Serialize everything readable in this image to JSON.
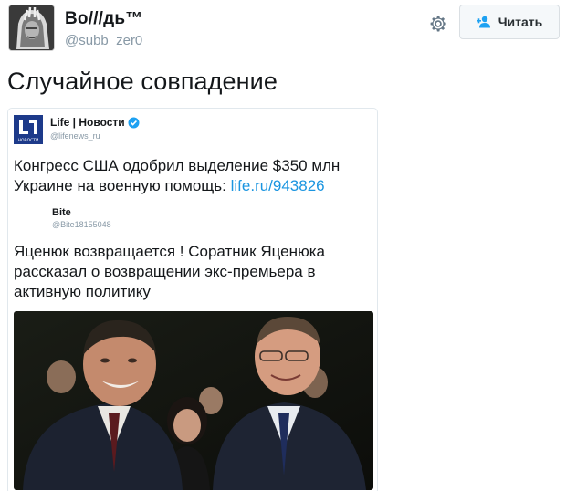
{
  "header": {
    "display_name": "Bo///дь™",
    "handle": "@subb_zer0",
    "follow_label": "Читать",
    "icons": {
      "settings": "gear-icon",
      "follow": "person-add-icon"
    }
  },
  "tweet": {
    "text": "Случайное совпадение"
  },
  "quote": {
    "author_name": "Life | Новости",
    "author_handle": "@lifenews_ru",
    "logo_caption": "НОВОСТИ",
    "text_before_link": "Конгресс США одобрил выделение $350 млн Украине на военную помощь: ",
    "link": "life.ru/943826",
    "nested": {
      "author_name": "Bite",
      "author_handle": "@Bite18155048",
      "text": "Яценюк возвращается ! Соратник Яценюка рассказал о возвращении экс-премьера в активную политику"
    }
  },
  "colors": {
    "link": "#1b95e0",
    "handle": "#8899a6",
    "verified": "#1da1f2",
    "life_logo": "#1d3a8a"
  }
}
